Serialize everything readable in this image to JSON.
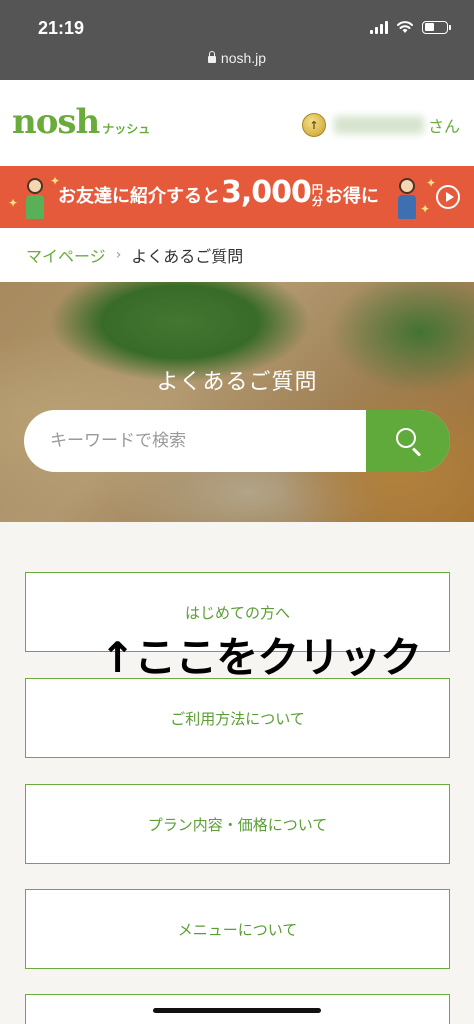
{
  "status_bar": {
    "time": "21:19",
    "url": "nosh.jp"
  },
  "header": {
    "logo_main": "nosh",
    "logo_sub": "ナッシュ",
    "coin_icon": "coin-icon",
    "user_suffix": "さん"
  },
  "banner": {
    "text_before": "お友達に紹介すると",
    "amount": "3,000",
    "unit_top": "円",
    "unit_bottom": "分",
    "text_after": "お得に",
    "play_icon": "play-circle-icon"
  },
  "breadcrumb": {
    "link": "マイページ",
    "separator": "›",
    "current": "よくあるご質問"
  },
  "hero": {
    "title": "よくあるご質問",
    "search_placeholder": "キーワードで検索",
    "search_icon": "search-icon"
  },
  "categories": [
    {
      "label": "はじめての方へ"
    },
    {
      "label": "ご利用方法について"
    },
    {
      "label": "プラン内容・価格について"
    },
    {
      "label": "メニューについて"
    },
    {
      "label": ""
    }
  ],
  "annotation": {
    "text": "↑ここをクリック"
  },
  "colors": {
    "brand_green": "#6aac3c",
    "banner_red": "#e65a3c",
    "search_button": "#5faa3a"
  }
}
